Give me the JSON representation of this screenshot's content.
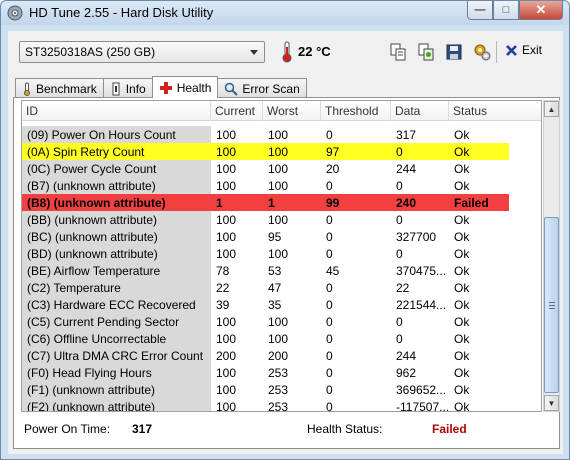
{
  "window": {
    "title": "HD Tune 2.55 - Hard Disk Utility"
  },
  "toolbar": {
    "drive": "ST3250318AS (250 GB)",
    "temperature": "22 °C",
    "exit_label": "Exit",
    "icons": [
      "copy-text-icon",
      "copy-screenshot-icon",
      "save-icon",
      "options-icon",
      "exit-icon"
    ]
  },
  "tabs": [
    {
      "label": "Benchmark",
      "icon": "thermometer-icon",
      "active": false
    },
    {
      "label": "Info",
      "icon": "info-icon",
      "active": false
    },
    {
      "label": "Health",
      "icon": "health-cross-icon",
      "active": true
    },
    {
      "label": "Error Scan",
      "icon": "magnifier-icon",
      "active": false
    }
  ],
  "table": {
    "columns": [
      "ID",
      "Current",
      "Worst",
      "Threshold",
      "Data",
      "Status"
    ],
    "rows": [
      {
        "id": "(09) Power On Hours Count",
        "current": "100",
        "worst": "100",
        "threshold": "0",
        "data": "317",
        "status": "Ok",
        "state": "normal"
      },
      {
        "id": "(0A) Spin Retry Count",
        "current": "100",
        "worst": "100",
        "threshold": "97",
        "data": "0",
        "status": "Ok",
        "state": "warn"
      },
      {
        "id": "(0C) Power Cycle Count",
        "current": "100",
        "worst": "100",
        "threshold": "20",
        "data": "244",
        "status": "Ok",
        "state": "normal"
      },
      {
        "id": "(B7) (unknown attribute)",
        "current": "100",
        "worst": "100",
        "threshold": "0",
        "data": "0",
        "status": "Ok",
        "state": "normal"
      },
      {
        "id": "(B8) (unknown attribute)",
        "current": "1",
        "worst": "1",
        "threshold": "99",
        "data": "240",
        "status": "Failed",
        "state": "fail"
      },
      {
        "id": "(BB) (unknown attribute)",
        "current": "100",
        "worst": "100",
        "threshold": "0",
        "data": "0",
        "status": "Ok",
        "state": "normal"
      },
      {
        "id": "(BC) (unknown attribute)",
        "current": "100",
        "worst": "95",
        "threshold": "0",
        "data": "327700",
        "status": "Ok",
        "state": "normal"
      },
      {
        "id": "(BD) (unknown attribute)",
        "current": "100",
        "worst": "100",
        "threshold": "0",
        "data": "0",
        "status": "Ok",
        "state": "normal"
      },
      {
        "id": "(BE) Airflow Temperature",
        "current": "78",
        "worst": "53",
        "threshold": "45",
        "data": "370475...",
        "status": "Ok",
        "state": "normal"
      },
      {
        "id": "(C2) Temperature",
        "current": "22",
        "worst": "47",
        "threshold": "0",
        "data": "22",
        "status": "Ok",
        "state": "normal"
      },
      {
        "id": "(C3) Hardware ECC Recovered",
        "current": "39",
        "worst": "35",
        "threshold": "0",
        "data": "221544...",
        "status": "Ok",
        "state": "normal"
      },
      {
        "id": "(C5) Current Pending Sector",
        "current": "100",
        "worst": "100",
        "threshold": "0",
        "data": "0",
        "status": "Ok",
        "state": "normal"
      },
      {
        "id": "(C6) Offline Uncorrectable",
        "current": "100",
        "worst": "100",
        "threshold": "0",
        "data": "0",
        "status": "Ok",
        "state": "normal"
      },
      {
        "id": "(C7) Ultra DMA CRC Error Count",
        "current": "200",
        "worst": "200",
        "threshold": "0",
        "data": "244",
        "status": "Ok",
        "state": "normal"
      },
      {
        "id": "(F0) Head Flying Hours",
        "current": "100",
        "worst": "253",
        "threshold": "0",
        "data": "962",
        "status": "Ok",
        "state": "normal"
      },
      {
        "id": "(F1) (unknown attribute)",
        "current": "100",
        "worst": "253",
        "threshold": "0",
        "data": "369652...",
        "status": "Ok",
        "state": "normal"
      },
      {
        "id": "(F2) (unknown attribute)",
        "current": "100",
        "worst": "253",
        "threshold": "0",
        "data": "-117507...",
        "status": "Ok",
        "state": "normal"
      }
    ]
  },
  "footer": {
    "power_on_label": "Power On Time:",
    "power_on_value": "317",
    "health_label": "Health Status:",
    "health_value": "Failed"
  },
  "colors": {
    "warn": "#ffff22",
    "fail": "#f24040",
    "failed_text": "#b00000",
    "id_column": "#d9d9d9"
  }
}
